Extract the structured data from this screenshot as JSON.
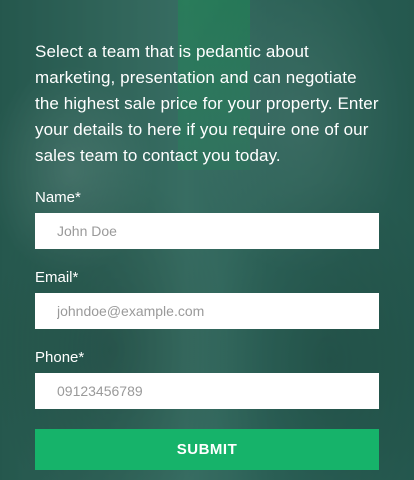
{
  "intro_text": "Select a team that is pedantic about marketing, presentation and can negotiate the highest sale price for your property. Enter your details to here if you require one of our sales team to contact you today.",
  "form": {
    "name": {
      "label": "Name*",
      "placeholder": "John Doe"
    },
    "email": {
      "label": "Email*",
      "placeholder": "johndoe@example.com"
    },
    "phone": {
      "label": "Phone*",
      "placeholder": "09123456789"
    },
    "submit_label": "SUBMIT"
  },
  "colors": {
    "overlay_tint": "#2f5a52",
    "submit_button": "#16b36a",
    "field_background": "#ffffff",
    "text": "#ffffff"
  }
}
